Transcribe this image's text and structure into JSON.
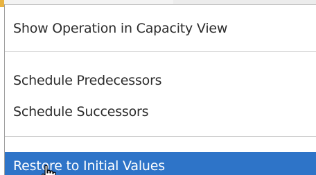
{
  "context_menu": {
    "items": [
      {
        "label": "Show Operation in Capacity View",
        "highlighted": false
      },
      {
        "label": "Schedule Predecessors",
        "highlighted": false
      },
      {
        "label": "Schedule Successors",
        "highlighted": false
      },
      {
        "label": "Restore to Initial Values",
        "highlighted": true
      }
    ]
  },
  "colors": {
    "highlight": "#2e74c8",
    "text": "#2b2b2b",
    "separator": "#cfcfcf"
  },
  "cursor": {
    "icon": "hand-pointer-icon"
  }
}
